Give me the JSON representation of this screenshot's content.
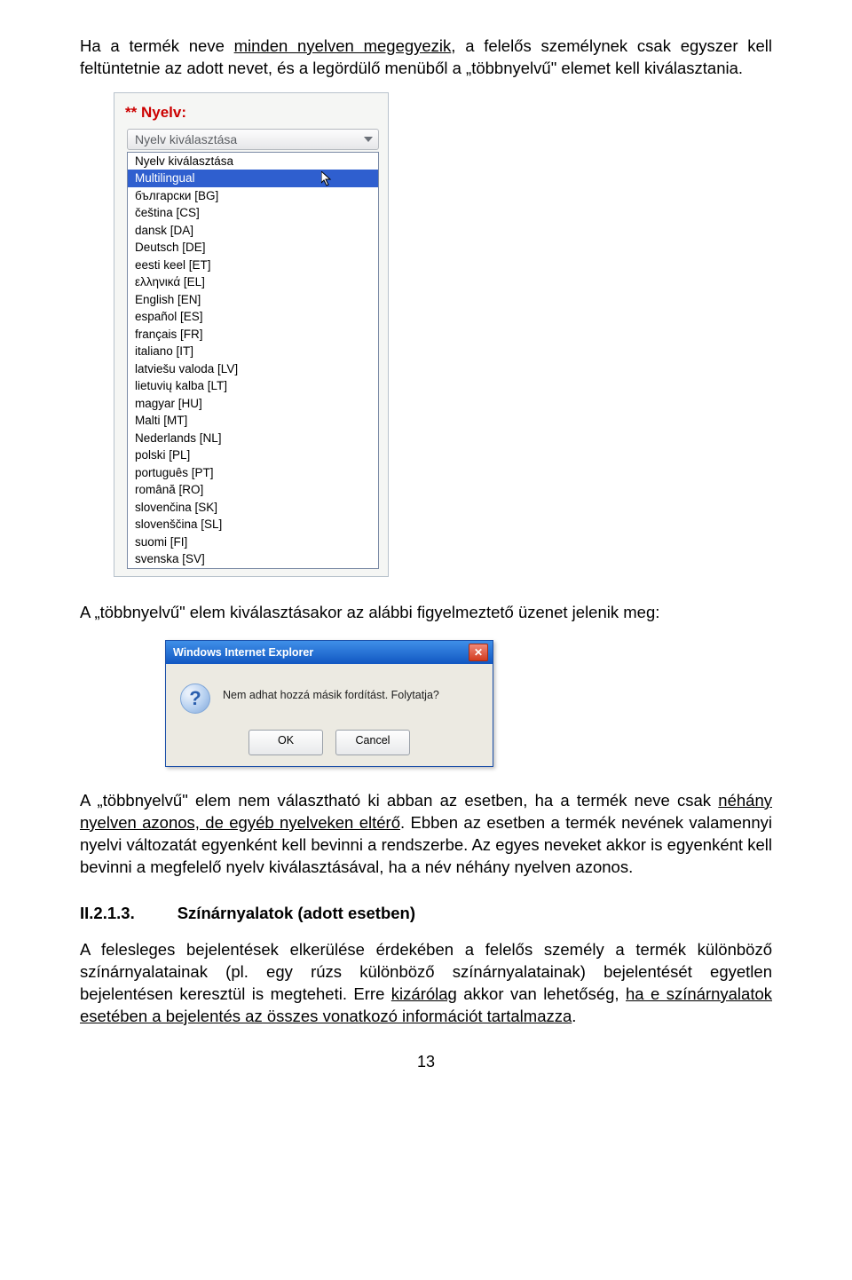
{
  "para1": {
    "pre": "Ha a termék neve ",
    "u1": "minden nyelven megegyezik",
    "post": ", a felelős személynek csak egyszer kell feltüntetnie az adott nevet, és a legördülő menüből a „többnyelvű\" elemet kell kiválasztania."
  },
  "dropdown": {
    "label_prefix": "** ",
    "label": "Nyelv:",
    "placeholder": "Nyelv kiválasztása",
    "items": [
      "Nyelv kiválasztása",
      "Multilingual",
      "български [BG]",
      "čeština [CS]",
      "dansk [DA]",
      "Deutsch [DE]",
      "eesti keel [ET]",
      "ελληνικά [EL]",
      "English [EN]",
      "español [ES]",
      "français [FR]",
      "italiano [IT]",
      "latviešu valoda [LV]",
      "lietuvių kalba [LT]",
      "magyar [HU]",
      "Malti [MT]",
      "Nederlands [NL]",
      "polski [PL]",
      "português [PT]",
      "română [RO]",
      "slovenčina [SK]",
      "slovenščina [SL]",
      "suomi [FI]",
      "svenska [SV]"
    ],
    "selected_index": 1
  },
  "para2": "A „többnyelvű\" elem kiválasztásakor az alábbi figyelmeztető üzenet jelenik meg:",
  "dialog": {
    "title": "Windows Internet Explorer",
    "message": "Nem adhat hozzá másik fordítást. Folytatja?",
    "ok": "OK",
    "cancel": "Cancel",
    "close_glyph": "✕"
  },
  "para3": {
    "pre": "A „többnyelvű\" elem nem választható ki abban az esetben, ha a termék neve csak ",
    "u1": "néhány nyelven azonos, de egyéb nyelveken eltérő",
    "post": ". Ebben az esetben a termék nevének valamennyi nyelvi változatát egyenként kell bevinni a rendszerbe. Az egyes neveket akkor is egyenként kell bevinni a megfelelő nyelv kiválasztásával, ha a név néhány nyelven azonos."
  },
  "section": {
    "number": "II.2.1.3.",
    "title": "Színárnyalatok (adott esetben)"
  },
  "para4": {
    "p1": "A felesleges bejelentések elkerülése érdekében a felelős személy a termék különböző színárnyalatainak (pl. egy rúzs különböző színárnyalatainak) bejelentését egyetlen bejelentésen keresztül is megteheti. Erre ",
    "u1": "kizárólag",
    "p2": " akkor van lehetőség, ",
    "u2": "ha e színárnyalatok esetében a bejelentés az összes vonatkozó információt tartalmazza",
    "p3": "."
  },
  "page_number": "13"
}
